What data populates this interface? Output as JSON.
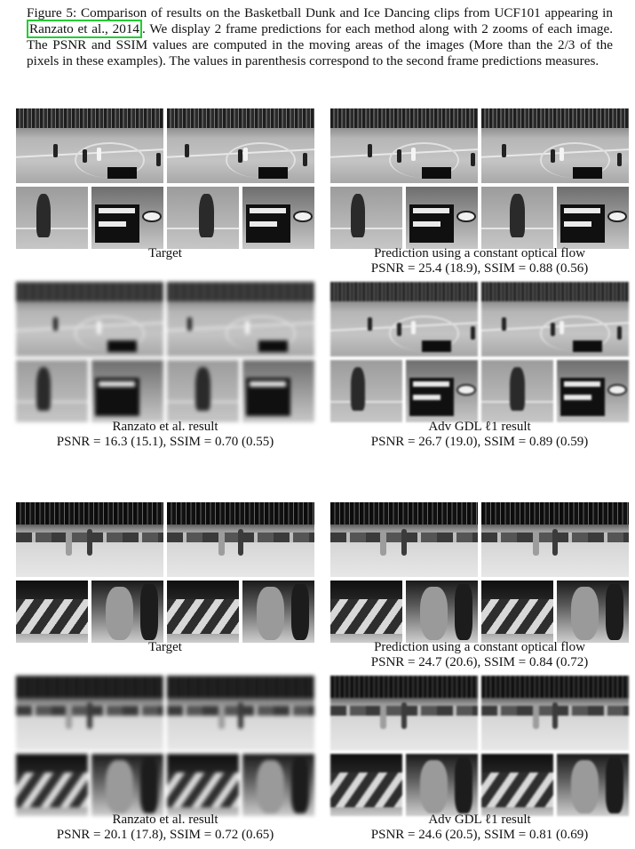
{
  "figure": {
    "caption_before": "Figure 5: Comparison of results on the Basketball Dunk and Ice Dancing clips from UCF101 appearing in ",
    "citation": "Ranzato et al., 2014",
    "caption_after": ". We display 2 frame predictions for each method along with 2 zooms of each image. The PSNR and SSIM values are computed in the moving areas of the images (More than the 2/3 of the pixels in these examples). The values in parenthesis correspond to the second frame predictions measures."
  },
  "basketball": {
    "target": {
      "title": "Target",
      "metrics": ""
    },
    "optical_flow": {
      "title": "Prediction using a constant optical flow",
      "metrics": "PSNR = 25.4 (18.9), SSIM = 0.88 (0.56)"
    },
    "ranzato": {
      "title": "Ranzato et al. result",
      "metrics": "PSNR = 16.3 (15.1), SSIM = 0.70 (0.55)"
    },
    "adv_gdl": {
      "title": "Adv GDL ℓ1 result",
      "metrics": "PSNR = 26.7 (19.0), SSIM = 0.89 (0.59)"
    }
  },
  "ice_dancing": {
    "target": {
      "title": "Target",
      "metrics": ""
    },
    "optical_flow": {
      "title": "Prediction using a constant optical flow",
      "metrics": "PSNR = 24.7 (20.6), SSIM = 0.84 (0.72)"
    },
    "ranzato": {
      "title": "Ranzato et al. result",
      "metrics": "PSNR = 20.1 (17.8), SSIM = 0.72 (0.65)"
    },
    "adv_gdl": {
      "title": "Adv GDL ℓ1 result",
      "metrics": "PSNR = 24.6 (20.5), SSIM = 0.81 (0.69)"
    }
  }
}
